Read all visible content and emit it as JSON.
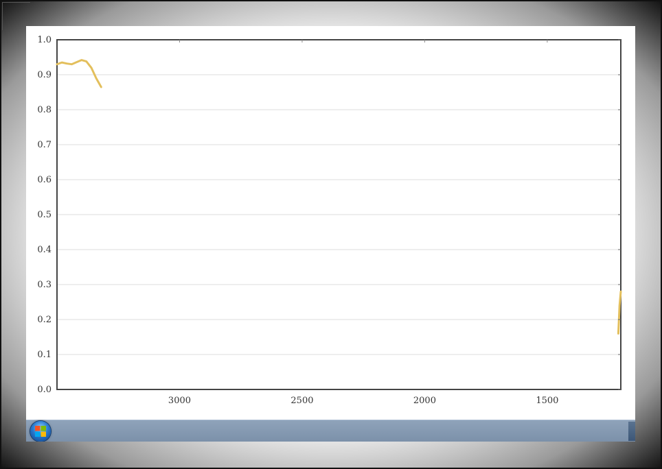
{
  "chart_data": {
    "type": "line",
    "title": "",
    "xlabel": "",
    "ylabel": "",
    "x_reversed": true,
    "xlim": [
      3500,
      1200
    ],
    "ylim": [
      0.0,
      1.0
    ],
    "xticks": [
      "3000",
      "2500",
      "2000",
      "1500"
    ],
    "xtick_values": [
      3000,
      2500,
      2000,
      1500
    ],
    "yticks": [
      "0.0",
      "0.1",
      "0.2",
      "0.3",
      "0.4",
      "0.5",
      "0.6",
      "0.7",
      "0.8",
      "0.9",
      "1.0"
    ],
    "ytick_values": [
      0.0,
      0.1,
      0.2,
      0.3,
      0.4,
      0.5,
      0.6,
      0.7,
      0.8,
      0.9,
      1.0
    ],
    "grid": "horizontal",
    "line_color": "#e3bf5c",
    "series": [
      {
        "segments": [
          {
            "x": [
              3500,
              3480,
              3460,
              3440,
              3420,
              3400,
              3380,
              3360,
              3340,
              3320
            ],
            "y": [
              0.93,
              0.935,
              0.932,
              0.93,
              0.936,
              0.942,
              0.938,
              0.92,
              0.89,
              0.865
            ]
          },
          {
            "x": [
              1210,
              1205,
              1200
            ],
            "y": [
              0.16,
              0.24,
              0.28
            ]
          }
        ]
      }
    ]
  },
  "taskbar": {
    "start_label": "Start"
  }
}
